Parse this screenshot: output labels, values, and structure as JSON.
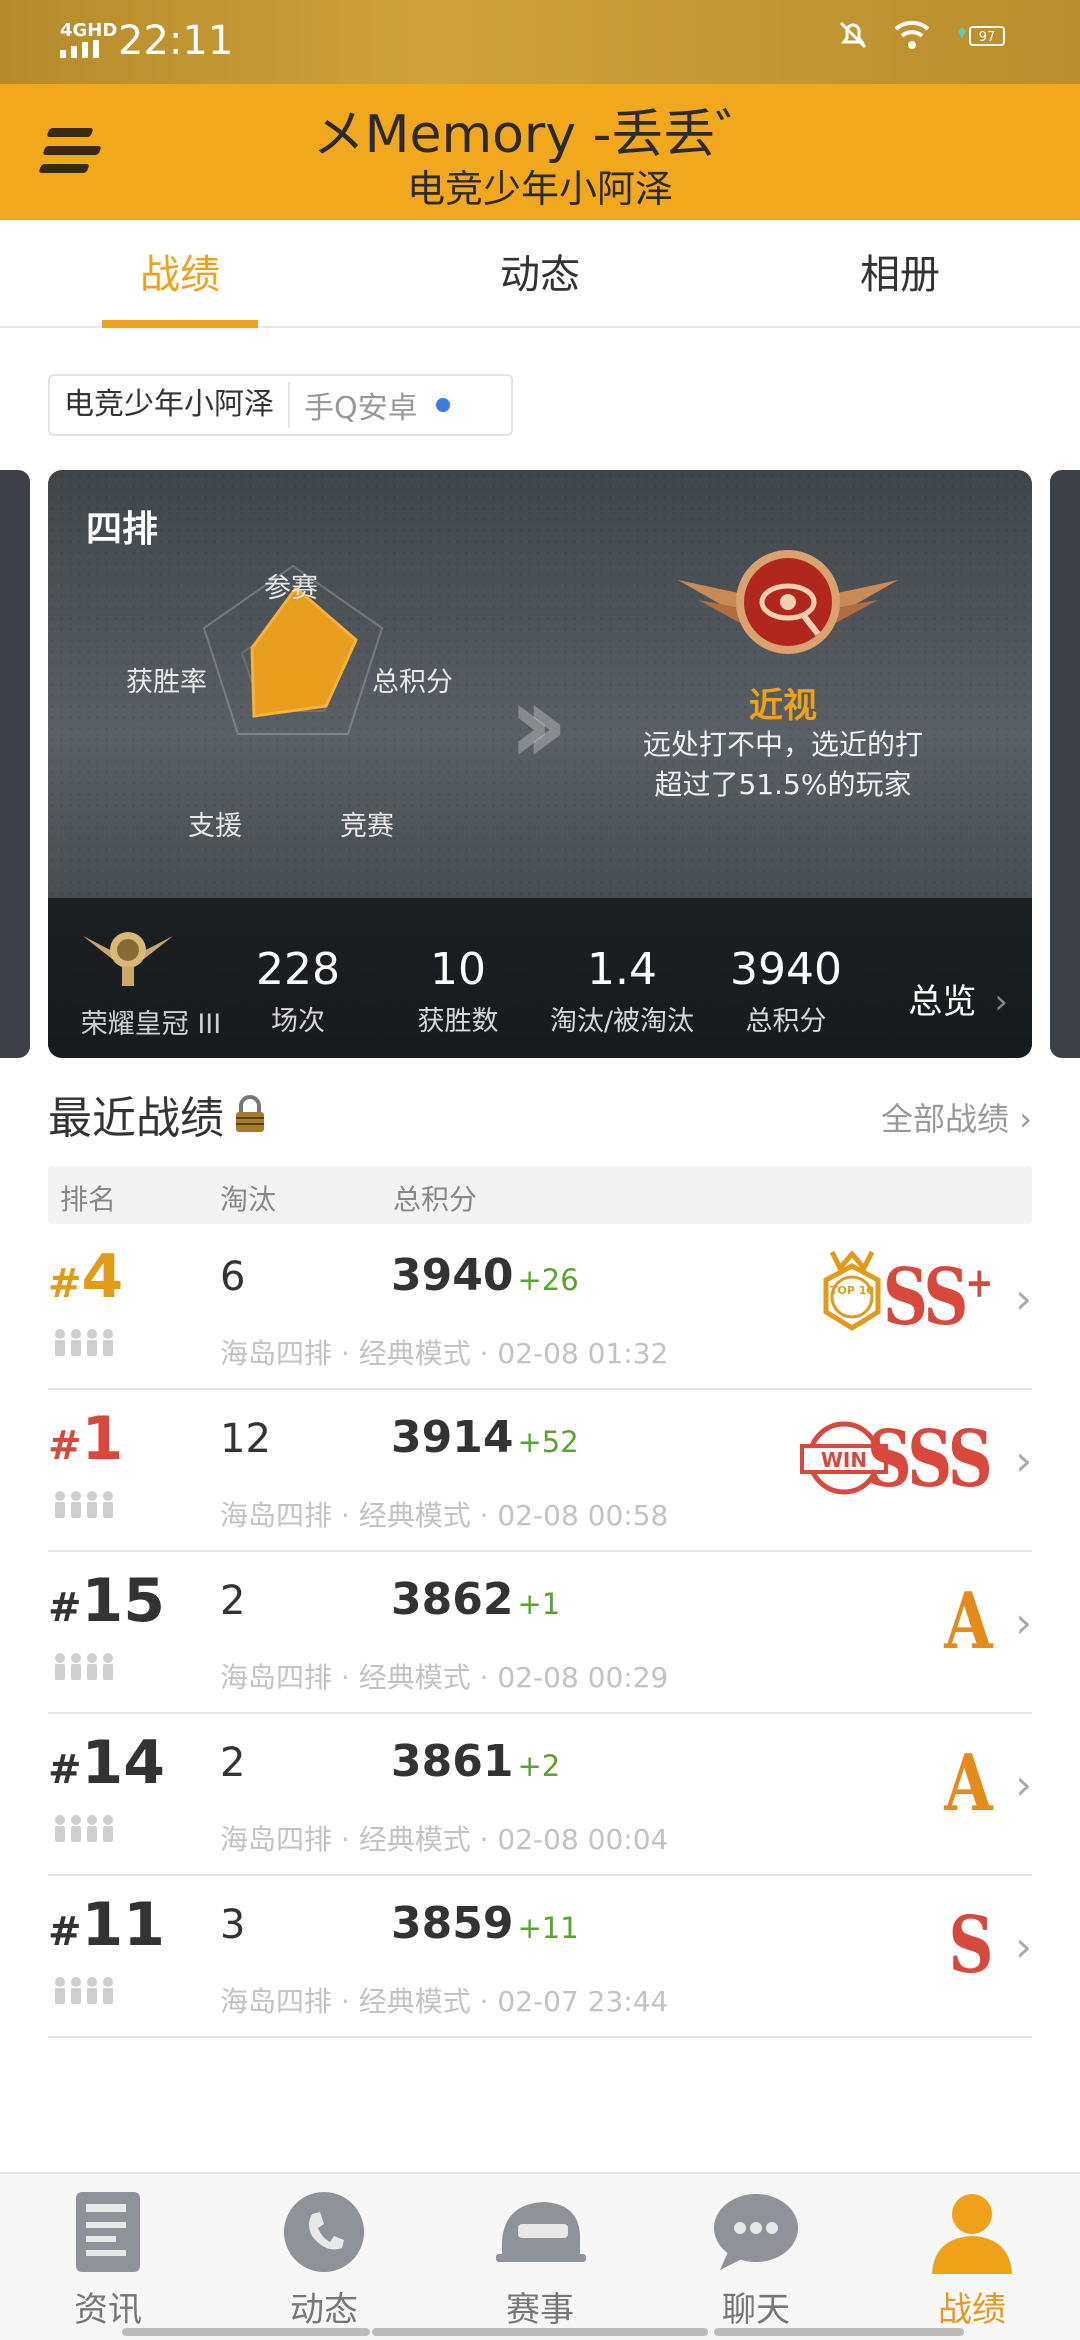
{
  "status_bar": {
    "network": "4GHD",
    "time": "22:11",
    "battery": "97"
  },
  "header": {
    "title": "メMemory -丢丢゛",
    "subtitle": "电竞少年小阿泽"
  },
  "tabs": [
    {
      "label": "战绩",
      "active": true
    },
    {
      "label": "动态",
      "active": false
    },
    {
      "label": "相册",
      "active": false
    }
  ],
  "account": {
    "name": "电竞少年小阿泽",
    "platform": "手Q安卓"
  },
  "card": {
    "mode": "四排",
    "radar": {
      "labels": {
        "top": "参赛",
        "left": "获胜率",
        "right": "总积分",
        "bottom_left": "支援",
        "bottom_right": "竞赛"
      }
    },
    "achievement": {
      "title": "近视",
      "line1": "远处打不中，选近的打",
      "line2": "超过了51.5%的玩家"
    },
    "rank_name": "荣耀皇冠 III",
    "stats": [
      {
        "value": "228",
        "label": "场次"
      },
      {
        "value": "10",
        "label": "获胜数"
      },
      {
        "value": "1.4",
        "label": "淘汰/被淘汰"
      },
      {
        "value": "3940",
        "label": "总积分"
      }
    ],
    "overview_label": "总览"
  },
  "recent": {
    "title": "最近战绩",
    "all_link": "全部战绩",
    "headers": {
      "rank": "排名",
      "kills": "淘汰",
      "score": "总积分"
    },
    "rows": [
      {
        "rank": "4",
        "kills": "6",
        "score": "3940",
        "delta": "+26",
        "meta": "海岛四排 · 经典模式 · 02-08 01:32",
        "grade": "SS",
        "grade_plus": "+",
        "medal": "TOP 10",
        "rank_color": "gold"
      },
      {
        "rank": "1",
        "kills": "12",
        "score": "3914",
        "delta": "+52",
        "meta": "海岛四排 · 经典模式 · 02-08 00:58",
        "grade": "SSS",
        "grade_plus": "",
        "medal": "WIN",
        "rank_color": "red"
      },
      {
        "rank": "15",
        "kills": "2",
        "score": "3862",
        "delta": "+1",
        "meta": "海岛四排 · 经典模式 · 02-08 00:29",
        "grade": "A",
        "grade_plus": "",
        "medal": "",
        "rank_color": "dark"
      },
      {
        "rank": "14",
        "kills": "2",
        "score": "3861",
        "delta": "+2",
        "meta": "海岛四排 · 经典模式 · 02-08 00:04",
        "grade": "A",
        "grade_plus": "",
        "medal": "",
        "rank_color": "dark"
      },
      {
        "rank": "11",
        "kills": "3",
        "score": "3859",
        "delta": "+11",
        "meta": "海岛四排 · 经典模式 · 02-07 23:44",
        "grade": "S",
        "grade_plus": "",
        "medal": "",
        "rank_color": "dark"
      }
    ]
  },
  "bottom_nav": [
    {
      "label": "资讯",
      "icon": "news-icon",
      "active": false
    },
    {
      "label": "动态",
      "icon": "phone-icon",
      "active": false
    },
    {
      "label": "赛事",
      "icon": "helmet-icon",
      "active": false
    },
    {
      "label": "聊天",
      "icon": "chat-bubble-icon",
      "active": false
    },
    {
      "label": "战绩",
      "icon": "user-icon",
      "active": true
    }
  ],
  "colors": {
    "accent": "#f2a81d",
    "header_bg": "#f2a81d",
    "delta_green": "#5aa42c",
    "grade_red": "#d8483d"
  }
}
